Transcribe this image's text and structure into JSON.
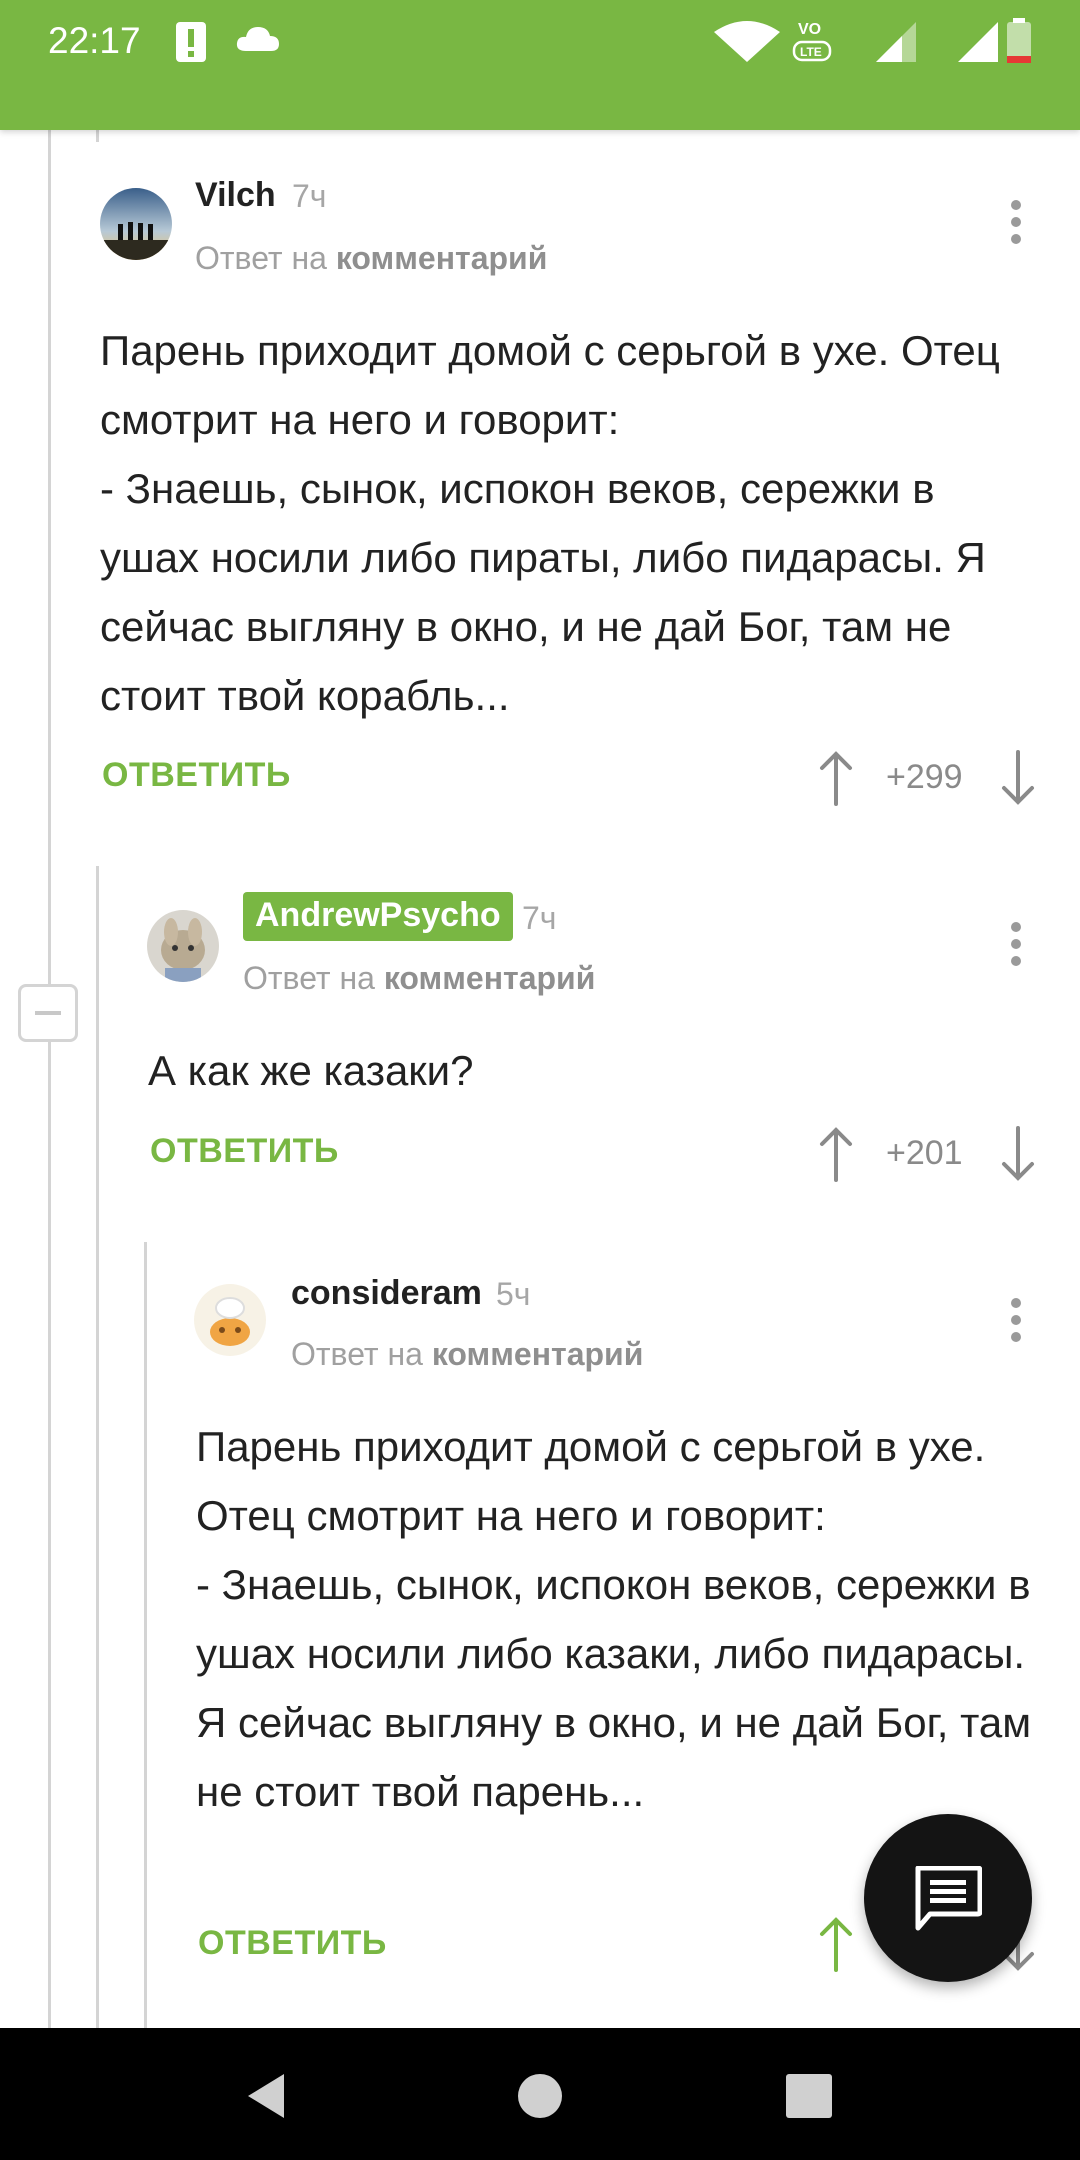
{
  "status_bar": {
    "time": "22:17",
    "icons": [
      "alert-icon",
      "cloud-icon",
      "wifi-icon",
      "volte-icon",
      "signal-icon",
      "battery-icon"
    ],
    "bg_color": "#79b743"
  },
  "comments": [
    {
      "author": "Vilch",
      "time": "7ч",
      "reply_prefix": "Ответ на",
      "reply_link": "комментарий",
      "text": "Парень приходит домой с серьгой в ухе. Отец смотрит на него и говорит:\n- Знаешь, сынок, испокон веков, сережки в ушах носили либо пираты, либо пидарасы. Я сейчас выгляну в окно, и не дай Бог, там не стоит твой корабль...",
      "reply_label": "ОТВЕТИТЬ",
      "rating": "+299"
    },
    {
      "author": "AndrewPsycho",
      "time": "7ч",
      "reply_prefix": "Ответ на",
      "reply_link": "комментарий",
      "text": "А как же казаки?",
      "reply_label": "ОТВЕТИТЬ",
      "rating": "+201"
    },
    {
      "author": "consideram",
      "time": "5ч",
      "reply_prefix": "Ответ на",
      "reply_link": "комментарий",
      "text": "Парень приходит домой с серьгой в ухе. Отец смотрит на него и говорит:\n- Знаешь, сынок, испокон веков, сережки в ушах носили либо казаки, либо пидарасы. Я сейчас выгляну в окно, и не дай Бог, там не стоит твой парень...",
      "reply_label": "ОТВЕТИТЬ",
      "rating": ""
    }
  ],
  "colors": {
    "accent": "#79b743",
    "text": "#222222",
    "muted": "#a0a0a0"
  },
  "fab": {
    "icon": "comment-icon"
  },
  "nav": {
    "icons": [
      "back-icon",
      "home-icon",
      "recents-icon"
    ]
  }
}
